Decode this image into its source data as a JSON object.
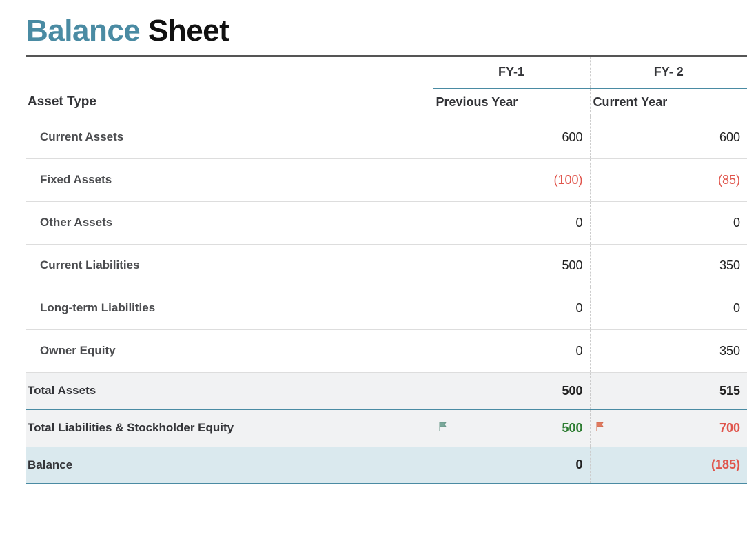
{
  "title": {
    "accent": "Balance",
    "rest": " Sheet"
  },
  "headers": {
    "asset_type": "Asset Type",
    "fy1": "FY-1",
    "fy2": "FY- 2",
    "col1": "Previous Year",
    "col2": "Current Year"
  },
  "rows": [
    {
      "label": "Current Assets",
      "v1": "600",
      "v1_neg": false,
      "v2": "600",
      "v2_neg": false
    },
    {
      "label": "Fixed Assets",
      "v1": "(100)",
      "v1_neg": true,
      "v2": "(85)",
      "v2_neg": true
    },
    {
      "label": "Other Assets",
      "v1": "0",
      "v1_neg": false,
      "v2": "0",
      "v2_neg": false
    },
    {
      "label": "Current Liabilities",
      "v1": "500",
      "v1_neg": false,
      "v2": "350",
      "v2_neg": false
    },
    {
      "label": "Long-term Liabilities",
      "v1": "0",
      "v1_neg": false,
      "v2": "0",
      "v2_neg": false
    },
    {
      "label": "Owner Equity",
      "v1": "0",
      "v1_neg": false,
      "v2": "350",
      "v2_neg": false
    }
  ],
  "summary": {
    "total_assets": {
      "label": "Total Assets",
      "v1": "500",
      "v2": "515"
    },
    "tlse": {
      "label": "Total Liabilities & Stockholder Equity",
      "v1": "500",
      "v2": "700",
      "flag1": "green",
      "flag2": "red"
    },
    "balance": {
      "label": "Balance",
      "v1": "0",
      "v1_neg": false,
      "v2": "(185)",
      "v2_neg": true
    }
  },
  "chart_data": {
    "type": "table",
    "title": "Balance Sheet",
    "columns": [
      "Asset Type",
      "FY-1 Previous Year",
      "FY-2 Current Year"
    ],
    "rows": [
      [
        "Current Assets",
        600,
        600
      ],
      [
        "Fixed Assets",
        -100,
        -85
      ],
      [
        "Other Assets",
        0,
        0
      ],
      [
        "Current Liabilities",
        500,
        350
      ],
      [
        "Long-term Liabilities",
        0,
        0
      ],
      [
        "Owner Equity",
        0,
        350
      ],
      [
        "Total Assets",
        500,
        515
      ],
      [
        "Total Liabilities & Stockholder Equity",
        500,
        700
      ],
      [
        "Balance",
        0,
        -185
      ]
    ]
  }
}
